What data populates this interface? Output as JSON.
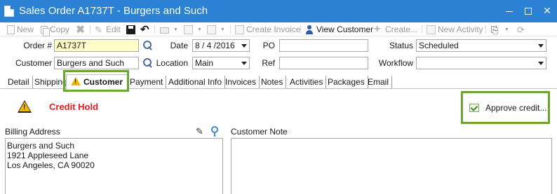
{
  "window": {
    "title": "Sales Order A1737T - Burgers and Such"
  },
  "toolbar": {
    "new_label": "New",
    "copy_label": "Copy",
    "edit_label": "Edit",
    "create_invoice_label": "Create Invoice",
    "view_customer_label": "View Customer",
    "create_label": "Create...",
    "new_activity_label": "New Activity"
  },
  "header": {
    "order_label": "Order #",
    "order_value": "A1737T",
    "customer_label": "Customer",
    "customer_value": "Burgers and Such",
    "date_label": "Date",
    "date_value": "8 / 4 /2016",
    "location_label": "Location",
    "location_value": "Main",
    "po_label": "PO",
    "po_value": "",
    "ref_label": "Ref",
    "ref_value": "",
    "status_label": "Status",
    "status_value": "Scheduled",
    "workflow_label": "Workflow",
    "workflow_value": ""
  },
  "tabs": [
    {
      "label": "Detail"
    },
    {
      "label": "Shipping"
    },
    {
      "label": "Customer"
    },
    {
      "label": "Payment"
    },
    {
      "label": "Additional Info"
    },
    {
      "label": "Invoices"
    },
    {
      "label": "Notes"
    },
    {
      "label": "Activities"
    },
    {
      "label": "Packages"
    },
    {
      "label": "Email"
    }
  ],
  "customer_tab": {
    "credit_hold_text": "Credit Hold",
    "approve_credit_label": "Approve credit...",
    "billing_address_label": "Billing Address",
    "billing_address_lines": [
      "Burgers and Such",
      "1921 Appleseed Lane",
      "Los Angeles, CA 90020"
    ],
    "customer_note_label": "Customer Note",
    "customer_note_value": ""
  },
  "colors": {
    "titlebar": "#2b82d4",
    "highlight": "#6aa731",
    "credit_hold": "#e01e1e",
    "order_field": "#fffdc7"
  }
}
